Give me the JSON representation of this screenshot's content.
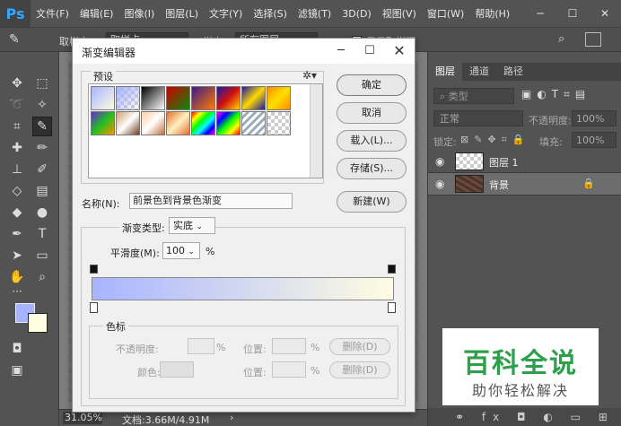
{
  "app": {
    "logo": "Ps"
  },
  "menubar": {
    "items": [
      "文件(F)",
      "编辑(E)",
      "图像(I)",
      "图层(L)",
      "文字(Y)",
      "选择(S)",
      "滤镜(T)",
      "3D(D)",
      "视图(V)",
      "窗口(W)",
      "帮助(H)"
    ]
  },
  "optbar": {
    "sample_label": "取样大",
    "sample_value": "取样点",
    "sample2_label": "样本:",
    "sample2_value": "所有图层",
    "ring_label": "显示取样环"
  },
  "statusbar": {
    "zoom": "31.05%",
    "doc": "文档:3.66M/4.91M"
  },
  "layers_panel": {
    "tabs": [
      "图层",
      "通道",
      "路径"
    ],
    "kind": "类型",
    "blend_mode": "正常",
    "opacity_label": "不透明度:",
    "opacity_value": "100%",
    "lock_label": "锁定:",
    "fill_label": "填充:",
    "fill_value": "100%",
    "layers": [
      {
        "name": "图层 1"
      },
      {
        "name": "背景"
      }
    ]
  },
  "watermark": {
    "main": "百科全说",
    "sub": "助你轻松解决"
  },
  "dialog": {
    "title": "渐变编辑器",
    "presets_label": "预设",
    "buttons": {
      "ok": "确定",
      "cancel": "取消",
      "load": "载入(L)...",
      "save": "存储(S)...",
      "new": "新建(W)"
    },
    "name_label": "名称(N):",
    "name_value": "前景色到背景色渐变",
    "gradient_type_label": "渐变类型:",
    "gradient_type_value": "实底",
    "smoothness_label": "平滑度(M):",
    "smoothness_value": "100",
    "smoothness_unit": "%",
    "gradient_colors": {
      "start": "#a7b4ff",
      "end": "#fffde2"
    },
    "stops": {
      "label": "色标",
      "opacity_label": "不透明度:",
      "opacity_unit": "%",
      "position_label": "位置:",
      "position_unit": "%",
      "delete_label": "删除(D)",
      "color_label": "颜色:"
    }
  }
}
